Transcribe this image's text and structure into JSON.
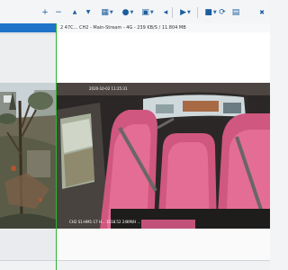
{
  "toolbar": {
    "buttons": [
      {
        "name": "add-icon",
        "glyph": "+"
      },
      {
        "name": "remove-icon",
        "glyph": "−"
      },
      {
        "name": "move-up-icon",
        "glyph": "▲"
      },
      {
        "name": "move-down-icon",
        "glyph": "▼"
      },
      {
        "name": "layout-icon",
        "glyph": "▦"
      },
      {
        "name": "record-icon",
        "glyph": "●"
      },
      {
        "name": "snapshot-icon",
        "glyph": "▣"
      },
      {
        "name": "audio-icon",
        "glyph": "◂"
      },
      {
        "name": "play-icon",
        "glyph": "▶"
      },
      {
        "name": "stop-icon",
        "glyph": "■"
      },
      {
        "name": "refresh-icon",
        "glyph": "⟳"
      },
      {
        "name": "save-icon",
        "glyph": "▤"
      },
      {
        "name": "delete-icon",
        "glyph": "✖"
      }
    ],
    "colors": {
      "icon": "#1b5e9e",
      "background": "#f4f5f7"
    }
  },
  "channel": {
    "info": "2  47C...   CH2 - Main-Stream - 4G - 239 KB/S / 11.804 MB"
  },
  "video": {
    "timestamp": "2020-10-02 11:25:31",
    "footer_text": "CH2  S1-HM1-17  H...  1018.52 24KM/H  ..."
  },
  "accent": {
    "selected": "#1f74c9",
    "divider": "#2fb52f"
  }
}
